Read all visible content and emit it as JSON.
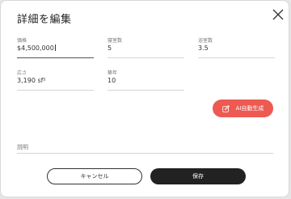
{
  "dialog": {
    "title": "詳細を編集",
    "close_icon": "close-icon"
  },
  "fields": {
    "price": {
      "label": "価格",
      "value": "$4,500,000"
    },
    "bedrooms": {
      "label": "寝室数",
      "value": "5"
    },
    "bathrooms": {
      "label": "浴室数",
      "value": "3.5"
    },
    "area": {
      "label": "広さ",
      "value": "3,190 sf²"
    },
    "age": {
      "label": "築年",
      "value": "10"
    }
  },
  "ai_button": {
    "label": "AI自動生成",
    "icon": "edit-icon",
    "color": "#ec5a52"
  },
  "description": {
    "label": "説明"
  },
  "footer": {
    "cancel_label": "キャンセル",
    "save_label": "保存"
  }
}
